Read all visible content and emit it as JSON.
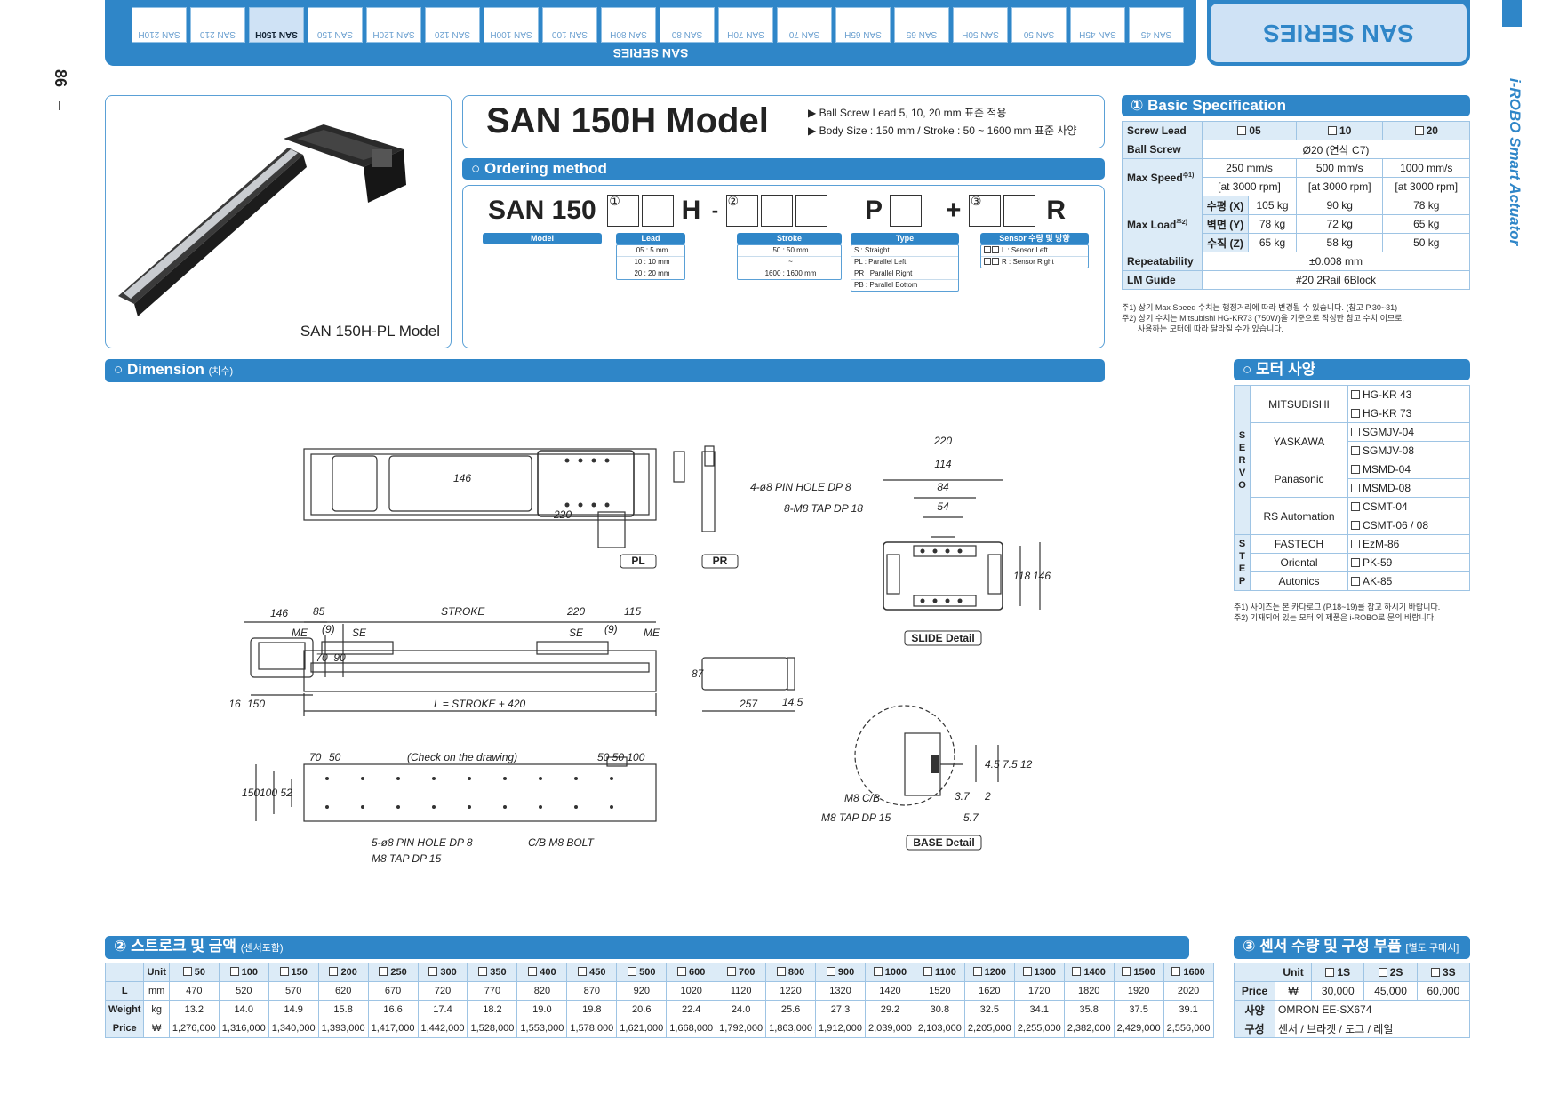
{
  "header": {
    "tabs": [
      "SAN 210H",
      "SAN 210",
      "SAN 150H",
      "SAN 150",
      "SAN 120H",
      "SAN 120",
      "SAN 100H",
      "SAN 100",
      "SAN 80H",
      "SAN 80",
      "SAN 70H",
      "SAN 70",
      "SAN 65H",
      "SAN 65",
      "SAN 50H",
      "SAN 50",
      "SAN 45H",
      "SAN 45"
    ],
    "active_tab": "SAN 150H",
    "series_label": "SAN SERIES",
    "series_badge": "SAN SERIES",
    "page_number": "86",
    "side_brand": "i-ROBO Smart Actuator"
  },
  "product": {
    "image_caption": "SAN 150H-PL Model",
    "model_title": "SAN 150H Model",
    "bullets": [
      "Ball Screw Lead 5, 10, 20 mm 표준 적용",
      "Body Size : 150 mm / Stroke : 50 ~ 1600 mm 표준 사양"
    ]
  },
  "ordering": {
    "title": "○ Ordering method",
    "code_prefix": "SAN 150",
    "circle1": "①",
    "circle2": "②",
    "circle3": "③",
    "letter_h": "H",
    "dash": "-",
    "letter_p": "P",
    "plus": "+",
    "letter_r": "R",
    "labels": {
      "model": "Model",
      "lead": "Lead",
      "stroke": "Stroke",
      "type": "Type",
      "sensor": "Sensor 수량 및 방향"
    },
    "lead_options": [
      "05 : 5 mm",
      "10 : 10 mm",
      "20 : 20 mm"
    ],
    "stroke_options": [
      "50 : 50 mm",
      "~",
      "1600 : 1600 mm"
    ],
    "type_options": [
      "S : Straight",
      "PL : Parallel Left",
      "PR : Parallel Right",
      "PB : Parallel Bottom"
    ],
    "sensor_options": [
      "L : Sensor Left",
      "R : Sensor Right"
    ]
  },
  "basic_spec": {
    "title": "① Basic Specification",
    "screw_lead_label": "Screw Lead",
    "leads": [
      "05",
      "10",
      "20"
    ],
    "ball_screw_label": "Ball Screw",
    "ball_screw_value": "Ø20 (연삭 C7)",
    "max_speed_label": "Max Speed",
    "max_speed_note": "주1)",
    "speeds": [
      "250 mm/s",
      "500 mm/s",
      "1000 mm/s"
    ],
    "rpm": [
      "[at 3000 rpm]",
      "[at 3000 rpm]",
      "[at 3000 rpm]"
    ],
    "max_load_label": "Max Load",
    "max_load_note": "주2)",
    "load_rows": [
      {
        "axis": "수평 (X)",
        "values": [
          "105 kg",
          "90 kg",
          "78 kg"
        ]
      },
      {
        "axis": "벽면 (Y)",
        "values": [
          "78 kg",
          "72 kg",
          "65 kg"
        ]
      },
      {
        "axis": "수직 (Z)",
        "values": [
          "65 kg",
          "58 kg",
          "50 kg"
        ]
      }
    ],
    "repeatability_label": "Repeatability",
    "repeatability_value": "±0.008 mm",
    "lm_guide_label": "LM Guide",
    "lm_guide_value": "#20 2Rail 6Block",
    "notes": [
      "주1) 상기 Max Speed 수치는 행정거리에 따라 변경될 수 있습니다. (참고 P.30~31)",
      "주2) 상기 수치는 Mitsubishi HG-KR73 (750W)을 기준으로 작성한 참고 수치 이므로,",
      "      사용하는 모터에 따라 달라질 수가 있습니다."
    ]
  },
  "motor": {
    "title": "○ 모터 사양",
    "servo_label": "SERVO",
    "step_label": "STEP",
    "servo": [
      {
        "brand": "MITSUBISHI",
        "models": [
          "HG-KR 43",
          "HG-KR 73"
        ]
      },
      {
        "brand": "YASKAWA",
        "models": [
          "SGMJV-04",
          "SGMJV-08"
        ]
      },
      {
        "brand": "Panasonic",
        "models": [
          "MSMD-04",
          "MSMD-08"
        ]
      },
      {
        "brand": "RS Automation",
        "models": [
          "CSMT-04",
          "CSMT-06 / 08"
        ]
      }
    ],
    "step": [
      {
        "brand": "FASTECH",
        "model": "EzM-86"
      },
      {
        "brand": "Oriental",
        "model": "PK-59"
      },
      {
        "brand": "Autonics",
        "model": "AK-85"
      }
    ],
    "notes": [
      "주1) 사이즈는 본 카다로그 (P.18~19)를 참고 하시기 바랍니다.",
      "주2) 기재되어 있는 모터 외 제품은 i-ROBO로 문의 바랍니다."
    ]
  },
  "dimension": {
    "title": "○ Dimension",
    "title_sub": "(치수)",
    "labels": {
      "pin_hole": "4-ø8 PIN HOLE DP 8",
      "tap": "8-M8 TAP DP 18",
      "pl": "PL",
      "pr": "PR",
      "slide_detail": "SLIDE Detail",
      "base_detail": "BASE Detail",
      "stroke": "STROKE",
      "l_formula": "L = STROKE + 420",
      "check": "(Check on the drawing)",
      "pin5": "5-ø8 PIN HOLE DP 8",
      "cb": "C/B M8 BOLT",
      "m8tap": "M8 TAP DP 15",
      "m8cb": "M8 C/B",
      "m8tap15": "M8 TAP DP 15",
      "me": "ME",
      "se": "SE",
      "nine": "(9)"
    },
    "nums": {
      "d220": "220",
      "d114": "114",
      "d84": "84",
      "d54": "54",
      "d118": "118",
      "d146": "146",
      "d85": "85",
      "d115": "115",
      "d150": "150",
      "d90": "90",
      "d70": "70",
      "d16": "16",
      "d87": "87",
      "d257": "257",
      "d14_5": "14.5",
      "d50": "50",
      "d100": "100",
      "d52": "52",
      "d50_50_100": "50 50 100",
      "d3_7": "3.7",
      "d2": "2",
      "d5_7": "5.7",
      "d4_5": "4.5",
      "d7_5": "7.5",
      "d12": "12"
    }
  },
  "price_table": {
    "title": "② 스트로크 및 금액",
    "title_sub": "(센서포함)",
    "unit_label": "Unit",
    "strokes": [
      "50",
      "100",
      "150",
      "200",
      "250",
      "300",
      "350",
      "400",
      "450",
      "500",
      "600",
      "700",
      "800",
      "900",
      "1000",
      "1100",
      "1200",
      "1300",
      "1400",
      "1500",
      "1600"
    ],
    "rows": [
      {
        "label": "L",
        "unit": "mm",
        "values": [
          "470",
          "520",
          "570",
          "620",
          "670",
          "720",
          "770",
          "820",
          "870",
          "920",
          "1020",
          "1120",
          "1220",
          "1320",
          "1420",
          "1520",
          "1620",
          "1720",
          "1820",
          "1920",
          "2020"
        ]
      },
      {
        "label": "Weight",
        "unit": "kg",
        "values": [
          "13.2",
          "14.0",
          "14.9",
          "15.8",
          "16.6",
          "17.4",
          "18.2",
          "19.0",
          "19.8",
          "20.6",
          "22.4",
          "24.0",
          "25.6",
          "27.3",
          "29.2",
          "30.8",
          "32.5",
          "34.1",
          "35.8",
          "37.5",
          "39.1"
        ]
      },
      {
        "label": "Price",
        "unit": "₩",
        "values": [
          "1,276,000",
          "1,316,000",
          "1,340,000",
          "1,393,000",
          "1,417,000",
          "1,442,000",
          "1,528,000",
          "1,553,000",
          "1,578,000",
          "1,621,000",
          "1,668,000",
          "1,792,000",
          "1,863,000",
          "1,912,000",
          "2,039,000",
          "2,103,000",
          "2,205,000",
          "2,255,000",
          "2,382,000",
          "2,429,000",
          "2,556,000"
        ]
      }
    ]
  },
  "sensor_table": {
    "title": "③ 센서 수량 및 구성 부품",
    "title_sub": "[별도 구매시]",
    "unit_label": "Unit",
    "cols": [
      "1S",
      "2S",
      "3S"
    ],
    "price_label": "Price",
    "price_unit": "₩",
    "prices": [
      "30,000",
      "45,000",
      "60,000"
    ],
    "spec_label": "사양",
    "spec_value": "OMRON  EE-SX674",
    "parts_label": "구성",
    "parts_value": "센서 / 브라켓 / 도그 / 레일"
  }
}
